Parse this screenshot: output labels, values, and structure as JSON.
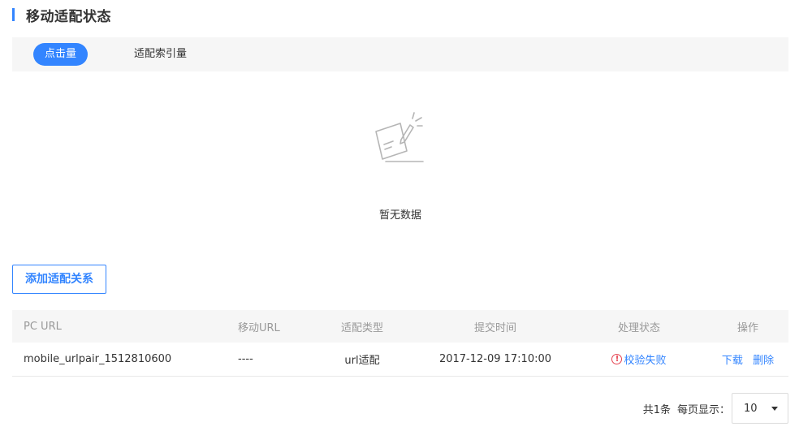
{
  "section": {
    "title": "移动适配状态"
  },
  "tabs": [
    {
      "label": "点击量",
      "active": true
    },
    {
      "label": "适配索引量",
      "active": false
    }
  ],
  "empty": {
    "text": "暂无数据",
    "icon": "empty-document-icon"
  },
  "add_button": {
    "label": "添加适配关系"
  },
  "table": {
    "headers": [
      "PC URL",
      "移动URL",
      "适配类型",
      "提交时间",
      "处理状态",
      "操作"
    ],
    "rows": [
      {
        "pc_url": "mobile_urlpair_1512810600",
        "mobile_url": "----",
        "type": "url适配",
        "time": "2017-12-09 17:10:00",
        "status": "校验失败",
        "status_icon": "warning-circle-icon",
        "status_color": "#3385ff",
        "actions": [
          "下载",
          "删除"
        ]
      }
    ]
  },
  "pagination": {
    "total": "共1条",
    "per_page_label": "每页显示：",
    "per_page_value": "10"
  },
  "colors": {
    "accent": "#3385ff",
    "error": "#e64552",
    "header_bg": "#f6f6f6"
  }
}
